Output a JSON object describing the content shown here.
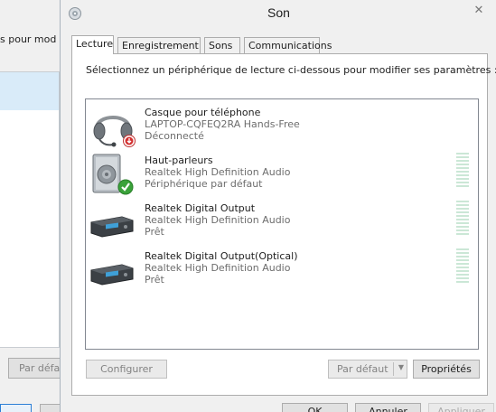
{
  "background_window": {
    "title_fragment": "s pour mod",
    "button_fragment": "Par défa"
  },
  "dialog": {
    "title": "Son",
    "close_glyph": "✕"
  },
  "tabs": [
    {
      "label": "Lecture",
      "active": true
    },
    {
      "label": "Enregistrement",
      "active": false
    },
    {
      "label": "Sons",
      "active": false
    },
    {
      "label": "Communications",
      "active": false
    }
  ],
  "instruction": "Sélectionnez un périphérique de lecture ci-dessous pour modifier ses paramètres :",
  "devices": [
    {
      "name": "Casque pour téléphone",
      "description": "LAPTOP-CQFEQ2RA Hands-Free",
      "status": "Déconnecté",
      "icon": "headset-icon",
      "badge": "disconnected-badge"
    },
    {
      "name": "Haut-parleurs",
      "description": "Realtek High Definition Audio",
      "status": "Périphérique par défaut",
      "icon": "speaker-icon",
      "badge": "default-check-badge"
    },
    {
      "name": "Realtek Digital Output",
      "description": "Realtek High Definition Audio",
      "status": "Prêt",
      "icon": "digital-output-icon"
    },
    {
      "name": "Realtek Digital Output(Optical)",
      "description": "Realtek High Definition Audio",
      "status": "Prêt",
      "icon": "digital-output-icon"
    }
  ],
  "buttons": {
    "configurer": "Configurer",
    "par_defaut": "Par défaut",
    "proprietes": "Propriétés",
    "ok": "OK",
    "annuler": "Annuler",
    "appliquer": "Appliquer"
  },
  "colors": {
    "selection": "#d9ebf9",
    "meter": "#cbe7d6",
    "check": "#3aa23a",
    "disconnect": "#d43030"
  }
}
